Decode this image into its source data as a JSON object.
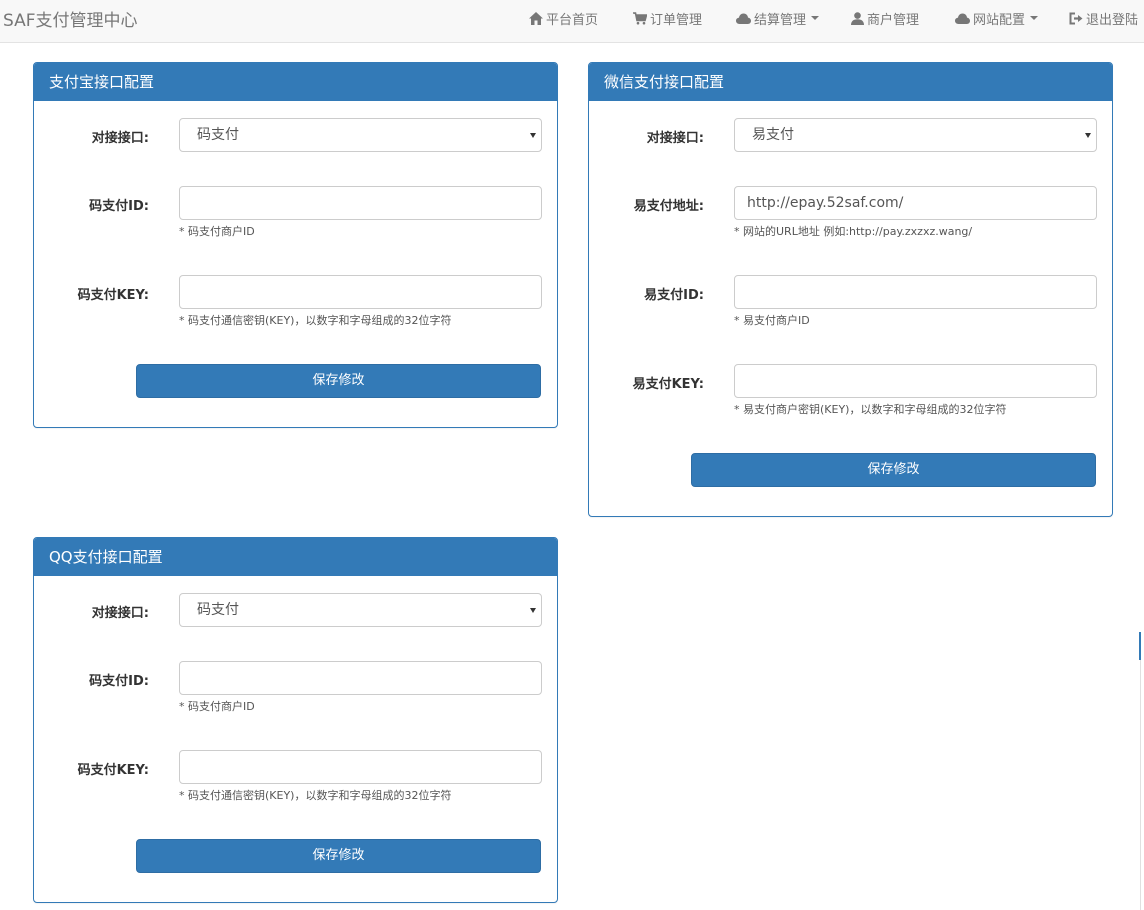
{
  "brand": "SAF支付管理中心",
  "nav": {
    "home": "平台首页",
    "orders": "订单管理",
    "settlement": "结算管理",
    "merchants": "商户管理",
    "site_config": "网站配置",
    "logout": "退出登陆"
  },
  "alipay_panel": {
    "title": "支付宝接口配置",
    "interface_label": "对接接口:",
    "interface_value": "码支付",
    "id_label": "码支付ID:",
    "id_value": "",
    "id_help": "* 码支付商户ID",
    "key_label": "码支付KEY:",
    "key_value": "",
    "key_help": "* 码支付通信密钥(KEY)，以数字和字母组成的32位字符",
    "save_label": "保存修改"
  },
  "wechat_panel": {
    "title": "微信支付接口配置",
    "interface_label": "对接接口:",
    "interface_value": "易支付",
    "url_label": "易支付地址:",
    "url_value": "http://epay.52saf.com/",
    "url_help": "* 网站的URL地址 例如:http://pay.zxzxz.wang/",
    "id_label": "易支付ID:",
    "id_value": "",
    "id_help": "* 易支付商户ID",
    "key_label": "易支付KEY:",
    "key_value": "",
    "key_help": "* 易支付商户密钥(KEY)，以数字和字母组成的32位字符",
    "save_label": "保存修改"
  },
  "qq_panel": {
    "title": "QQ支付接口配置",
    "interface_label": "对接接口:",
    "interface_value": "码支付",
    "id_label": "码支付ID:",
    "id_value": "",
    "id_help": "* 码支付商户ID",
    "key_label": "码支付KEY:",
    "key_value": "",
    "key_help": "* 码支付通信密钥(KEY)，以数字和字母组成的32位字符",
    "save_label": "保存修改"
  },
  "colors": {
    "primary": "#337ab7",
    "navbar_bg": "#f8f8f8",
    "nav_text": "#777777"
  },
  "icons": {
    "home": "home-icon",
    "orders": "shopping-cart-icon",
    "settlement": "cloud-icon",
    "merchants": "user-icon",
    "site_config": "cloud-icon",
    "logout": "logout-icon"
  }
}
